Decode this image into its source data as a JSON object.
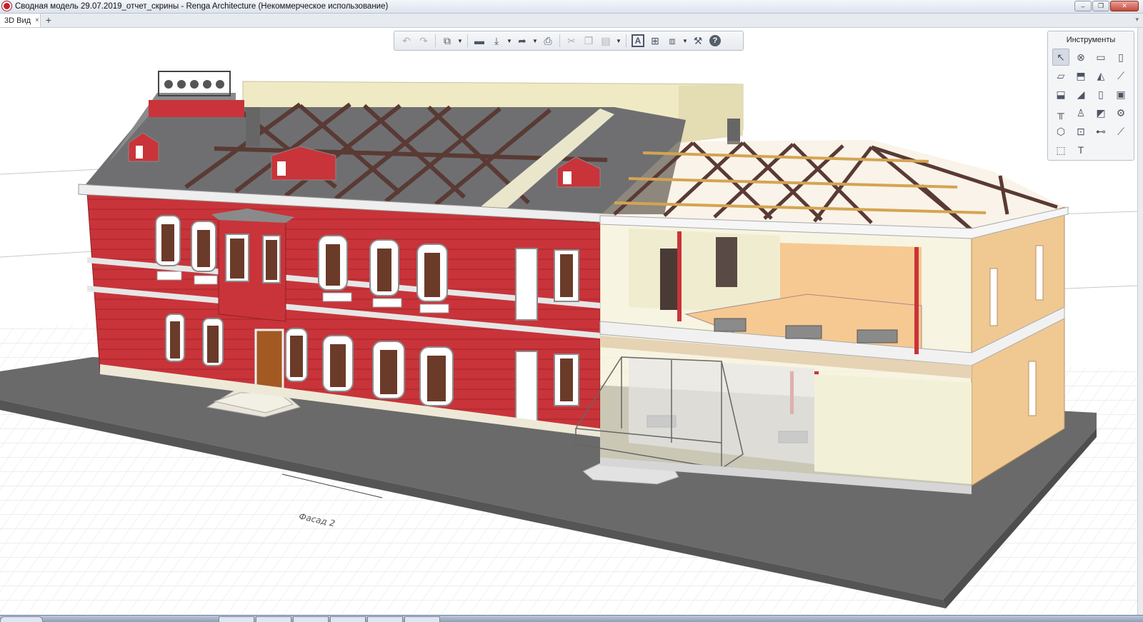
{
  "window": {
    "title": "Сводная модель 29.07.2019_отчет_скрины - Renga Architecture (Некоммерческое использование)",
    "controls": {
      "minimize": "–",
      "restore": "❐",
      "close": "✕"
    }
  },
  "tabs": [
    {
      "label": "3D Вид",
      "close": "×"
    }
  ],
  "tab_add": "+",
  "tab_menu": "▾",
  "toolbar": {
    "items": [
      {
        "icon": "undo-icon",
        "glyph": "↶",
        "disabled": true
      },
      {
        "icon": "redo-icon",
        "glyph": "↷",
        "disabled": true
      },
      {
        "icon": "views-icon",
        "glyph": "⧉"
      },
      {
        "icon": "open-icon",
        "glyph": "▬"
      },
      {
        "icon": "save-icon",
        "glyph": "⤓"
      },
      {
        "icon": "export-icon",
        "glyph": "➦"
      },
      {
        "icon": "print-icon",
        "glyph": "⎙"
      },
      {
        "icon": "cut-icon",
        "glyph": "✂"
      },
      {
        "icon": "copy-icon",
        "glyph": "❐"
      },
      {
        "icon": "paste-icon",
        "glyph": "📋"
      },
      {
        "icon": "text-style-icon",
        "glyph": "A"
      },
      {
        "icon": "structure-icon",
        "glyph": "⊞"
      },
      {
        "icon": "layers-icon",
        "glyph": "⧈"
      },
      {
        "icon": "settings-wrench-icon",
        "glyph": "🔧"
      },
      {
        "icon": "help-icon",
        "glyph": "?"
      }
    ]
  },
  "tools_panel": {
    "title": "Инструменты",
    "tools": [
      {
        "icon": "select-cursor-icon",
        "glyph": "↖",
        "selected": true
      },
      {
        "icon": "axes-icon",
        "glyph": "⊗"
      },
      {
        "icon": "level-icon",
        "glyph": "▭"
      },
      {
        "icon": "wall-icon",
        "glyph": "▯"
      },
      {
        "icon": "slab-icon",
        "glyph": "▱"
      },
      {
        "icon": "floor-icon",
        "glyph": "⬒"
      },
      {
        "icon": "roof-icon",
        "glyph": "◭"
      },
      {
        "icon": "beam-icon",
        "glyph": "⟋"
      },
      {
        "icon": "ramp-icon",
        "glyph": "⬓"
      },
      {
        "icon": "stair-icon",
        "glyph": "◢"
      },
      {
        "icon": "door-icon",
        "glyph": "▯"
      },
      {
        "icon": "window-icon",
        "glyph": "▣"
      },
      {
        "icon": "railing-icon",
        "glyph": "╥"
      },
      {
        "icon": "column-icon",
        "glyph": "♙"
      },
      {
        "icon": "foundation-icon",
        "glyph": "◩"
      },
      {
        "icon": "equipment-icon",
        "glyph": "⚙"
      },
      {
        "icon": "room-icon",
        "glyph": "⬡"
      },
      {
        "icon": "opening-icon",
        "glyph": "⊡"
      },
      {
        "icon": "dimension-icon",
        "glyph": "⊷"
      },
      {
        "icon": "line-icon",
        "glyph": "⟋"
      },
      {
        "icon": "hatch-icon",
        "glyph": "⬚"
      },
      {
        "icon": "text-tool-icon",
        "glyph": "T"
      }
    ]
  },
  "viewport": {
    "facade_label": "Фасад 2"
  },
  "colors": {
    "facade_red": "#c8343a",
    "roof_gray": "#6e6e70",
    "base_gray": "#6a6a6a",
    "beam_brown": "#5a3a34",
    "wall_cream": "#ece8c8",
    "wall_peach": "#f0c892"
  }
}
